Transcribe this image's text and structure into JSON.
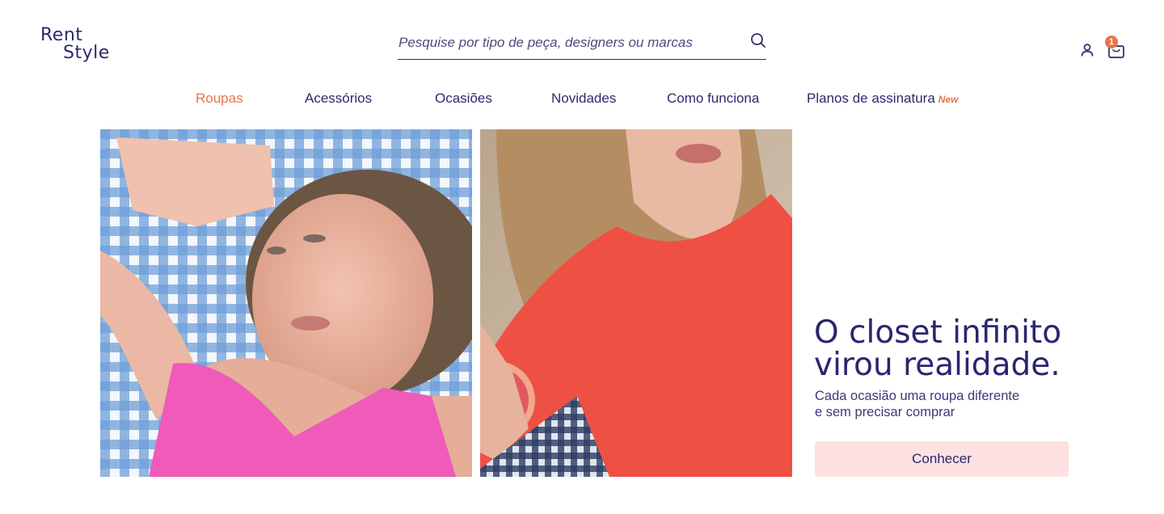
{
  "brand": {
    "line1": "Rent",
    "line2": "Style"
  },
  "search": {
    "placeholder": "Pesquise por tipo de peça, designers ou marcas",
    "value": ""
  },
  "cart": {
    "count": "1"
  },
  "nav": {
    "items": [
      {
        "label": "Roupas",
        "active": true
      },
      {
        "label": "Acessórios"
      },
      {
        "label": "Ocasiões"
      },
      {
        "label": "Novidades"
      },
      {
        "label": "Como funciona"
      },
      {
        "label": "Planos de assinatura",
        "tag": "New"
      }
    ]
  },
  "hero": {
    "title_line1": "O closet infinito",
    "title_line2": "virou realidade.",
    "subtitle_line1": "Cada ocasião uma roupa diferente",
    "subtitle_line2": "e sem precisar comprar",
    "cta_label": "Conhecer"
  },
  "colors": {
    "primary": "#2b2a6e",
    "accent": "#e8744f",
    "cta_bg": "#fde1e1"
  },
  "icons": [
    "search-icon",
    "user-icon",
    "shopping-bag-icon"
  ]
}
